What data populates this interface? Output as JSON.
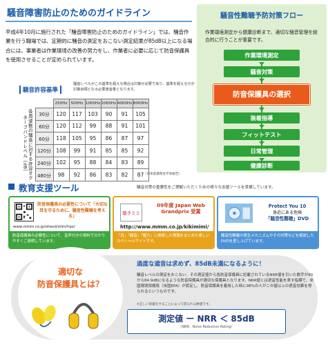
{
  "guideline": {
    "title": "騒音障害防止のためのガイドライン",
    "body": "平成4年10月に施行された「騒音障害防止のためのガイドライン」では、騒音作業を行う職場では、定期的に騒音の測定をおこない測定結果が85dB以上になる場合には、事業者は作業環境の改善の努力をし、作業者に必要に応じて防音保護具を使用させることが定められています。",
    "limit_label": "騒音許容基準",
    "limit_note": "騒音レベルがこの基準を超える場合は対策が必要であり、基準を超える分が対策目標となる必要遮音量となります。",
    "side_label": "各周波数の騒音に対する許容オクターブバンドレベル〔dB〕",
    "source": "（日本産業衛生学会勧告）",
    "colors": {
      "accent": "#1a5aa8",
      "rule": "#5aa0d8"
    }
  },
  "noise_table": {
    "headers": [
      "250Hz",
      "500Hz",
      "1000Hz",
      "2000Hz",
      "4000Hz",
      "8000Hz"
    ],
    "rows": [
      {
        "level": "30分",
        "values": [
          "120",
          "117",
          "103",
          "90",
          "91",
          "105"
        ]
      },
      {
        "level": "60分",
        "values": [
          "120",
          "112",
          "99",
          "88",
          "91",
          "101"
        ]
      },
      {
        "level": "60分",
        "values": [
          "118",
          "105",
          "95",
          "86",
          "87",
          "97"
        ]
      },
      {
        "level": "120分",
        "values": [
          "108",
          "99",
          "91",
          "85",
          "85",
          "92"
        ]
      },
      {
        "level": "240分",
        "values": [
          "102",
          "95",
          "88",
          "84",
          "83",
          "89"
        ]
      },
      {
        "level": "480分",
        "values": [
          "98",
          "92",
          "86",
          "83",
          "82",
          "87"
        ]
      }
    ]
  },
  "flow": {
    "title": "騒音性難聴予防対策フロー",
    "description": "作業環境測定から健康診断まで、適切な騒音管理を総合的に行うことが重要です。",
    "steps": [
      {
        "label": "作業環境測定",
        "primary": false
      },
      {
        "label": "騒音対策",
        "primary": false
      },
      {
        "label": "防音保護具の選択",
        "primary": true
      },
      {
        "label": "装着指導",
        "primary": false
      },
      {
        "label": "フィットテスト",
        "primary": false
      },
      {
        "label": "日常管理",
        "primary": false
      },
      {
        "label": "健康診断",
        "primary": false
      }
    ],
    "colors": {
      "background": "#dff0d2",
      "step": "#2fa33a",
      "primary": "#e85b1a"
    }
  },
  "education": {
    "title": "教育支援ツール",
    "caption": "騒音対策の重要性をご理解いただくための様々な支援ツールを準備しています。",
    "cards": [
      {
        "headline": "防音保護具の必要性について「大切な耳を守るために、騒音性難聴を考える」",
        "url": "www.mmm.co.jp/ohesd/stim/hps/",
        "footer": "防音保護具の必要性について、音声付きの資料で分かりやすくご説明しています。"
      },
      {
        "logo_text": "聴きミミ",
        "award": "09年度 Japan Web Grandprix 受賞",
        "url": "http://www.mmm.co.jp/kikimimi/",
        "footer": "「耳」「騒音」「聴力」に関連した情報をまとめた楽しいスペシャルサイトです。"
      },
      {
        "headline": "Protect You 10",
        "sub": "身近にある危険",
        "dvd": "「騒音性難聴」DVD",
        "footer": "騒音性難聴の発生メカニズムやその対策などを解説したDVDを差し上げています。"
      }
    ],
    "colors": {
      "card1": "#40a63f",
      "card2": "#e8a31a",
      "card3": "#4d92d6"
    }
  },
  "protector": {
    "question_line1": "適切な",
    "question_line2": "防音保護具とは？",
    "headline": "過度な遮音は求めず、85dB未満になるように！",
    "body": "騒音レベルの測定をおこない、その測定値から各防音保護具に記載されているNRR値を引いた数字が80から84.9dBになるような防音保護具が適切な保護具となります。NRR値とは遮音性能を表す指標で、米国環境保護局（米国EPA）が認定し、防音保護具を着用した時に98%の人がこの値以上の遮音効果を得られるというものです。",
    "note": "※正しい装着をすることによって得られる数値です。",
    "formula": "測定値 ー NRR ＜ 85dB",
    "formula_sub": "（NRR：Noise Reduction Rating）",
    "colors": {
      "question": "#e8611a",
      "formula_border": "#1a5aa8"
    }
  }
}
